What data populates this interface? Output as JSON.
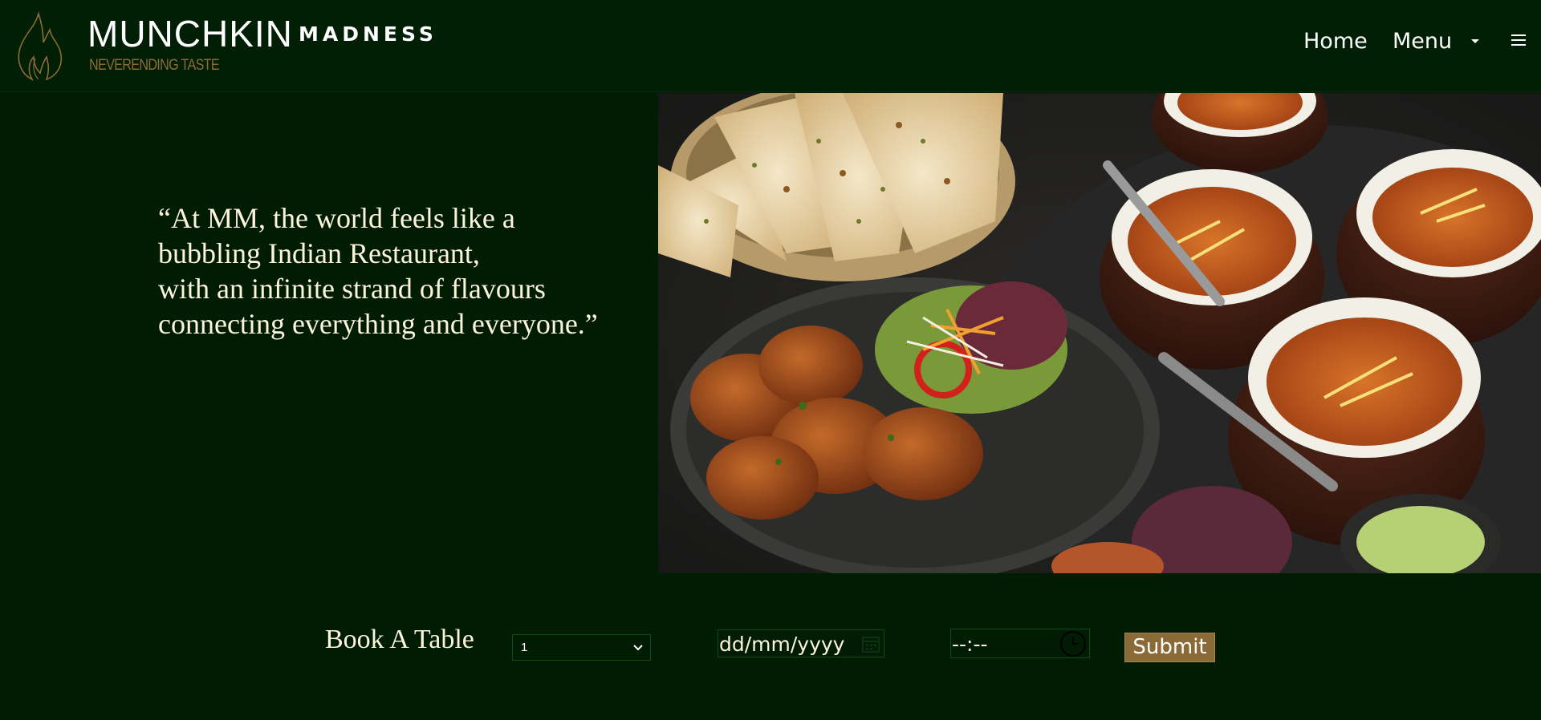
{
  "header": {
    "brand_main": "MUNCHKIN",
    "brand_second": "MADNESS",
    "tagline": "NEVERENDING TASTE",
    "nav": {
      "home": "Home",
      "menu": "Menu"
    }
  },
  "hero": {
    "quote_lines": [
      "“At MM, the world feels like a",
      "bubbling Indian Restaurant,",
      "with an infinite strand of flavours",
      "connecting everything and everyone.”"
    ]
  },
  "booking": {
    "label": "Book A Table",
    "guests_selected": "1",
    "date_placeholder": "dd/mm/yyyy",
    "time_placeholder": "--:--",
    "submit_label": "Submit"
  },
  "colors": {
    "background": "#001d03",
    "header_background": "#001f05",
    "accent_gold": "#8a6a36",
    "text_cream": "#fdf4dc",
    "field_border": "#0f4a17"
  },
  "icons": [
    "flame-logo-icon",
    "caret-down-icon",
    "hamburger-icon",
    "chevron-down-icon",
    "calendar-icon",
    "clock-icon"
  ]
}
